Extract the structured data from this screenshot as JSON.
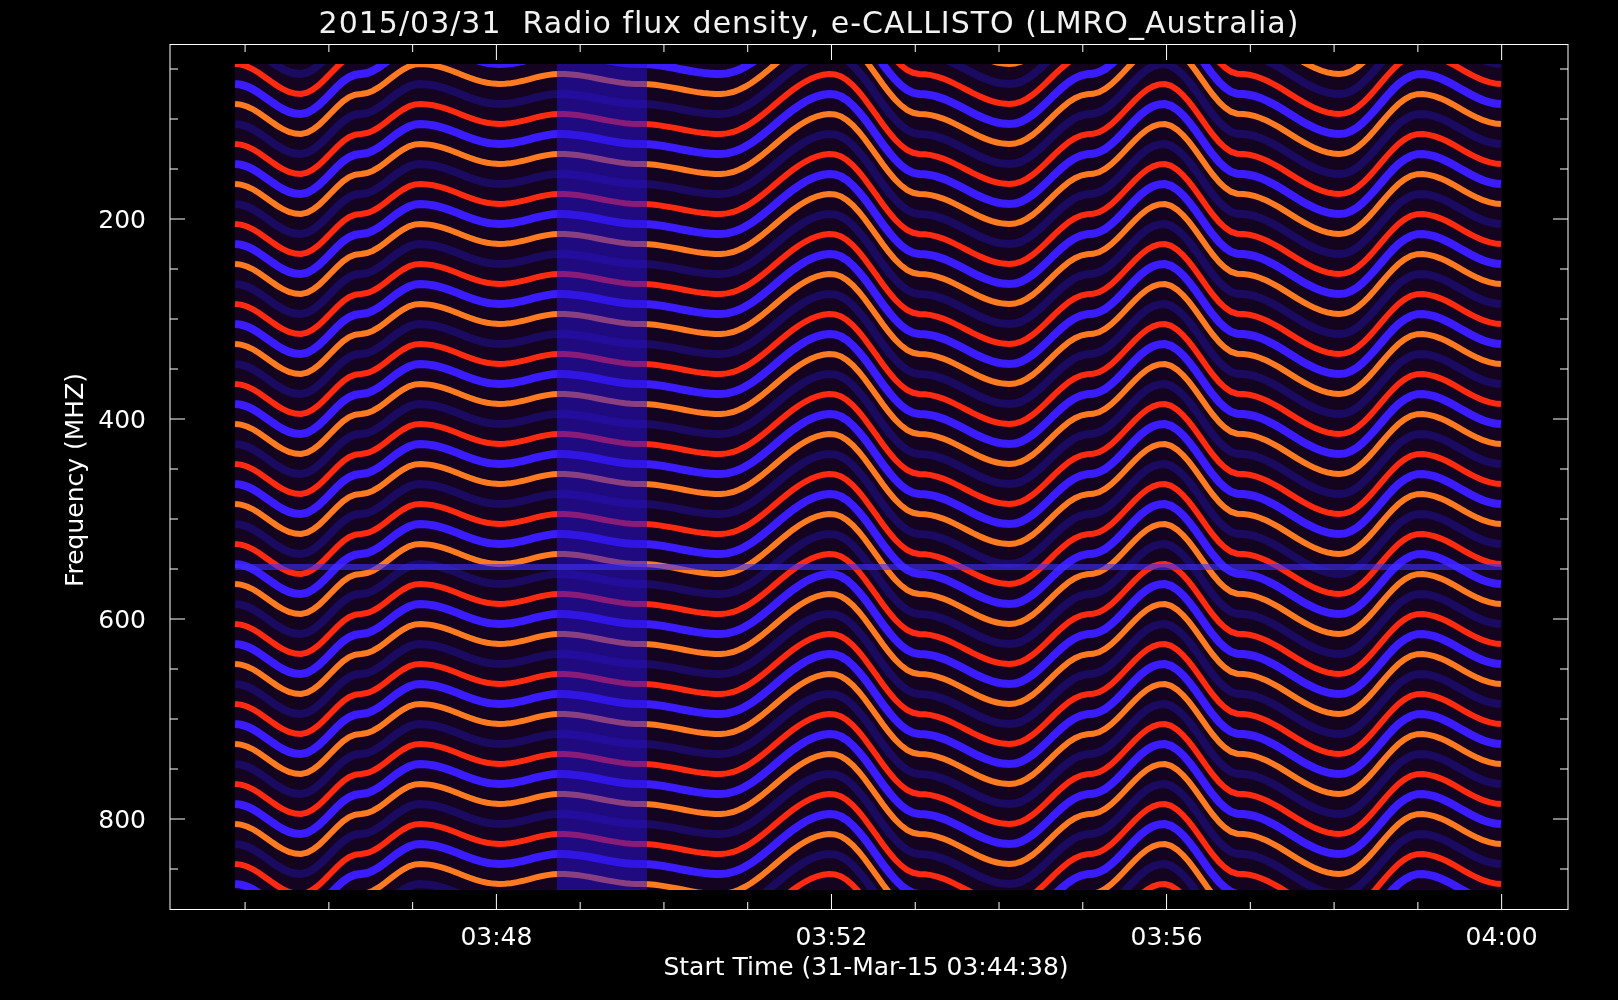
{
  "title": "2015/03/31  Radio flux density, e-CALLISTO (LMRO_Australia)",
  "chart": {
    "ylabel": "Frequency (MHZ)",
    "xlabel": "Start Time (31-Mar-15 03:44:38)",
    "yticks": [
      "200",
      "400",
      "600",
      "800"
    ],
    "xticks": [
      "03:48",
      "03:52",
      "03:56",
      "04:00"
    ]
  }
}
